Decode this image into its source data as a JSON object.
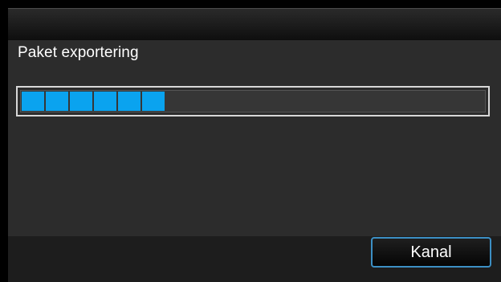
{
  "dialog": {
    "heading": "Paket exportering",
    "progress": {
      "filled_segments": 6,
      "fraction": 0.31,
      "color": "#0aa3ef"
    },
    "cancel_label": "Kanal"
  },
  "colors": {
    "background": "#2c2c2c",
    "title_bar": "#1e1e1e",
    "footer": "#1d1d1d",
    "accent": "#0aa3ef",
    "button_border": "#3c8fc4"
  }
}
